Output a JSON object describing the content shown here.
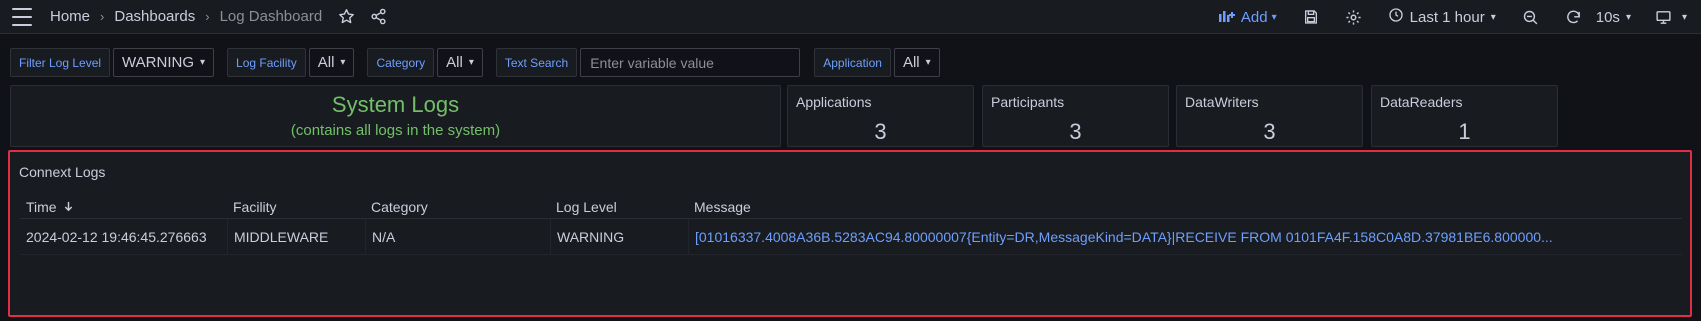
{
  "header": {
    "breadcrumb": [
      "Home",
      "Dashboards",
      "Log Dashboard"
    ],
    "add_label": "Add",
    "time_range": "Last 1 hour",
    "refresh_interval": "10s",
    "accent_color": "#6e9fff"
  },
  "variables": [
    {
      "label": "Filter Log Level",
      "value": "WARNING"
    },
    {
      "label": "Log Facility",
      "value": "All"
    },
    {
      "label": "Category",
      "value": "All"
    },
    {
      "label": "Text Search",
      "placeholder": "Enter variable value"
    },
    {
      "label": "Application",
      "value": "All"
    }
  ],
  "system_logs": {
    "title": "System Logs",
    "subtitle": "(contains all logs in the system)",
    "color": "#73bf69"
  },
  "stats": [
    {
      "title": "Applications",
      "value": "3"
    },
    {
      "title": "Participants",
      "value": "3"
    },
    {
      "title": "DataWriters",
      "value": "3"
    },
    {
      "title": "DataReaders",
      "value": "1"
    }
  ],
  "logs_panel": {
    "title": "Connext Logs",
    "columns": [
      "Time",
      "Facility",
      "Category",
      "Log Level",
      "Message"
    ],
    "rows": [
      {
        "time": "2024-02-12 19:46:45.276663",
        "facility": "MIDDLEWARE",
        "category": "N/A",
        "log_level": "WARNING",
        "message": "[01016337.4008A36B.5283AC94.80000007{Entity=DR,MessageKind=DATA}|RECEIVE FROM 0101FA4F.158C0A8D.37981BE6.800000..."
      }
    ],
    "highlight_color": "#e02f44"
  }
}
